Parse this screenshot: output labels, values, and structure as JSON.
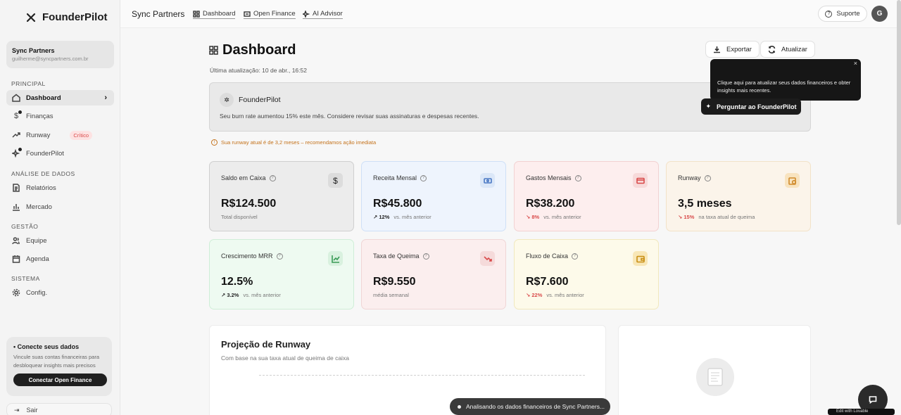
{
  "brand": {
    "name": "FounderPilot"
  },
  "account": {
    "name": "Sync Partners",
    "email": "guilherme@syncpartners.com.br"
  },
  "sidebar": {
    "sections": {
      "principal": "PRINCIPAL",
      "analise": "ANÁLISE DE DADOS",
      "gestao": "GESTÃO",
      "sistema": "SISTEMA"
    },
    "items": {
      "dashboard": "Dashboard",
      "financas": "Finanças",
      "runway": "Runway",
      "runway_badge": "Crítico",
      "founderpilot": "FounderPilot",
      "relatorios": "Relatórios",
      "mercado": "Mercado",
      "equipe": "Equipe",
      "agenda": "Agenda",
      "config": "Config."
    },
    "connect": {
      "title": "Conecte seus dados",
      "desc": "Vincule suas contas financeiras para desbloquear insights mais precisos",
      "button": "Conectar Open Finance"
    },
    "logout": "Sair"
  },
  "topbar": {
    "company": "Sync Partners",
    "links": {
      "dashboard": "Dashboard",
      "open_finance": "Open Finance",
      "ai_advisor": "AI Advisor"
    },
    "support": "Suporte",
    "avatar_initial": "G"
  },
  "header": {
    "title": "Dashboard",
    "updated": "Última atualização: 10 de abr., 16:52",
    "export": "Exportar",
    "refresh": "Atualizar"
  },
  "ai": {
    "title": "FounderPilot",
    "message": "Seu burn rate aumentou 15% este mês. Considere revisar suas assinaturas e despesas recentes.",
    "ask_button": "Perguntar ao FounderPilot",
    "tooltip": "Clique aqui para atualizar seus dados financeiros e obter insights mais recentes.",
    "tooltip_close": "×"
  },
  "warning": "Sua runway atual é de 3,2 meses – recomendamos ação imediata",
  "cards": {
    "saldo": {
      "label": "Saldo em Caixa",
      "value": "R$124.500",
      "sub": "Total disponível"
    },
    "receita": {
      "label": "Receita Mensal",
      "value": "R$45.800",
      "change": "12%",
      "sub": "vs. mês anterior"
    },
    "gastos": {
      "label": "Gastos Mensais",
      "value": "R$38.200",
      "change": "8%",
      "sub": "vs. mês anterior"
    },
    "runway": {
      "label": "Runway",
      "value": "3,5 meses",
      "change": "15%",
      "sub": "na taxa atual de queima"
    },
    "mrr": {
      "label": "Crescimento MRR",
      "value": "12.5%",
      "change": "3.2%",
      "sub": "vs. mês anterior"
    },
    "queima": {
      "label": "Taxa de Queima",
      "value": "R$9.550",
      "sub": "média semanal"
    },
    "fluxo": {
      "label": "Fluxo de Caixa",
      "value": "R$7.600",
      "change": "22%",
      "sub": "vs. mês anterior"
    }
  },
  "projection": {
    "title": "Projeção de Runway",
    "subtitle": "Com base na sua taxa atual de queima de caixa"
  },
  "toast": "Analisando os dados financeiros de Sync Partners...",
  "edit_badge": "Edit with Lovable",
  "colors": {
    "danger": "#d94b4b",
    "warning": "#c4721b",
    "dark": "#1c1c1c"
  }
}
